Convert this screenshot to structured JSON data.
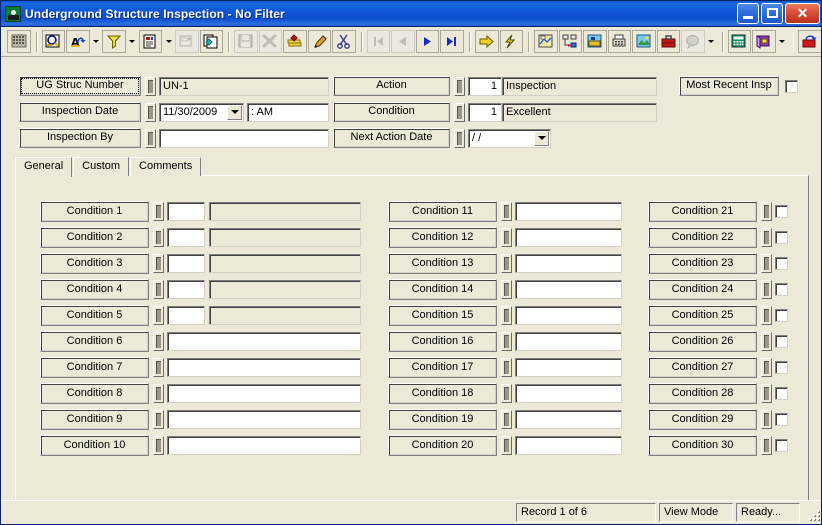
{
  "window": {
    "title": "Underground Structure Inspection - No Filter",
    "icon": "underground-structure-icon",
    "minimize_label": "Minimize",
    "maximize_label": "Maximize",
    "close_label": "Close",
    "close_glyph": "✕"
  },
  "toolbar": {
    "buttons": [
      {
        "name": "grid-view-icon",
        "tip": "Grid View"
      },
      {
        "name": "find-icon",
        "tip": "Find"
      },
      {
        "name": "sort-icon",
        "tip": "Sort"
      },
      {
        "name": "filter-icon",
        "tip": "Filter"
      },
      {
        "name": "report-icon",
        "tip": "Report"
      },
      {
        "name": "form-design-icon",
        "tip": "Form Design"
      },
      {
        "name": "copy-record-icon",
        "tip": "Copy Record"
      },
      {
        "name": "save-icon",
        "tip": "Save"
      },
      {
        "name": "delete-icon",
        "tip": "Delete"
      },
      {
        "name": "new-record-icon",
        "tip": "New Record"
      },
      {
        "name": "edit-icon",
        "tip": "Edit"
      },
      {
        "name": "cut-icon",
        "tip": "Cut"
      },
      {
        "name": "first-record-icon",
        "tip": "First Record"
      },
      {
        "name": "previous-record-icon",
        "tip": "Previous Record"
      },
      {
        "name": "next-record-icon",
        "tip": "Next Record"
      },
      {
        "name": "last-record-icon",
        "tip": "Last Record"
      },
      {
        "name": "goto-icon",
        "tip": "Go To"
      },
      {
        "name": "lightning-icon",
        "tip": "Quick Action"
      },
      {
        "name": "map-icon",
        "tip": "Map"
      },
      {
        "name": "hierarchy-icon",
        "tip": "Hierarchy"
      },
      {
        "name": "attachment-icon",
        "tip": "Attachment"
      },
      {
        "name": "fax-icon",
        "tip": "Fax"
      },
      {
        "name": "picture-icon",
        "tip": "Picture"
      },
      {
        "name": "toolbox-icon",
        "tip": "Toolbox"
      },
      {
        "name": "help-balloon-icon",
        "tip": "Help"
      },
      {
        "name": "calculator-icon",
        "tip": "Calculator"
      },
      {
        "name": "book-icon",
        "tip": "Reference"
      },
      {
        "name": "exit-icon",
        "tip": "Exit"
      }
    ]
  },
  "header": {
    "ug_struc_number": {
      "label": "UG Struc Number",
      "value": "UN-1",
      "focused": true
    },
    "inspection_date": {
      "label": "Inspection Date",
      "value": "11/30/2009",
      "time_value": ":    AM"
    },
    "inspection_by": {
      "label": "Inspection By",
      "value": ""
    },
    "action": {
      "label": "Action",
      "code": "1",
      "description": "Inspection"
    },
    "condition": {
      "label": "Condition",
      "code": "1",
      "description": "Excellent"
    },
    "next_action_date": {
      "label": "Next Action Date",
      "value": "/  /"
    },
    "most_recent_insp": {
      "label": "Most Recent Insp",
      "checked": false
    }
  },
  "tabs": [
    {
      "label": "General",
      "active": true
    },
    {
      "label": "Custom",
      "active": false
    },
    {
      "label": "Comments",
      "active": false
    }
  ],
  "conditions": {
    "column1": [
      {
        "label": "Condition 1",
        "code": "",
        "description": "",
        "type": "code-desc"
      },
      {
        "label": "Condition 2",
        "code": "",
        "description": "",
        "type": "code-desc"
      },
      {
        "label": "Condition 3",
        "code": "",
        "description": "",
        "type": "code-desc"
      },
      {
        "label": "Condition 4",
        "code": "",
        "description": "",
        "type": "code-desc"
      },
      {
        "label": "Condition 5",
        "code": "",
        "description": "",
        "type": "code-desc"
      },
      {
        "label": "Condition 6",
        "value": "",
        "type": "text"
      },
      {
        "label": "Condition 7",
        "value": "",
        "type": "text"
      },
      {
        "label": "Condition 8",
        "value": "",
        "type": "text"
      },
      {
        "label": "Condition 9",
        "value": "",
        "type": "text"
      },
      {
        "label": "Condition 10",
        "value": "",
        "type": "text"
      }
    ],
    "column2": [
      {
        "label": "Condition 11",
        "value": "",
        "type": "text"
      },
      {
        "label": "Condition 12",
        "value": "",
        "type": "text"
      },
      {
        "label": "Condition 13",
        "value": "",
        "type": "text"
      },
      {
        "label": "Condition 14",
        "value": "",
        "type": "text"
      },
      {
        "label": "Condition 15",
        "value": "",
        "type": "text"
      },
      {
        "label": "Condition 16",
        "value": "",
        "type": "text"
      },
      {
        "label": "Condition 17",
        "value": "",
        "type": "text"
      },
      {
        "label": "Condition 18",
        "value": "",
        "type": "text"
      },
      {
        "label": "Condition 19",
        "value": "",
        "type": "text"
      },
      {
        "label": "Condition 20",
        "value": "",
        "type": "text"
      }
    ],
    "column3": [
      {
        "label": "Condition 21",
        "checked": false,
        "type": "checkbox"
      },
      {
        "label": "Condition 22",
        "checked": false,
        "type": "checkbox"
      },
      {
        "label": "Condition 23",
        "checked": false,
        "type": "checkbox"
      },
      {
        "label": "Condition 24",
        "checked": false,
        "type": "checkbox"
      },
      {
        "label": "Condition 25",
        "checked": false,
        "type": "checkbox"
      },
      {
        "label": "Condition 26",
        "checked": false,
        "type": "checkbox"
      },
      {
        "label": "Condition 27",
        "checked": false,
        "type": "checkbox"
      },
      {
        "label": "Condition 28",
        "checked": false,
        "type": "checkbox"
      },
      {
        "label": "Condition 29",
        "checked": false,
        "type": "checkbox"
      },
      {
        "label": "Condition 30",
        "checked": false,
        "type": "checkbox"
      }
    ]
  },
  "statusbar": {
    "record": "Record 1 of 6",
    "mode": "View Mode",
    "state": "Ready..."
  },
  "colors": {
    "title_active": "#0f54d6",
    "face": "#ece9d8",
    "field": "#ffffff",
    "readonly_field": "#ece9d8",
    "border_dark": "#808080",
    "close_button": "#d9503a"
  }
}
